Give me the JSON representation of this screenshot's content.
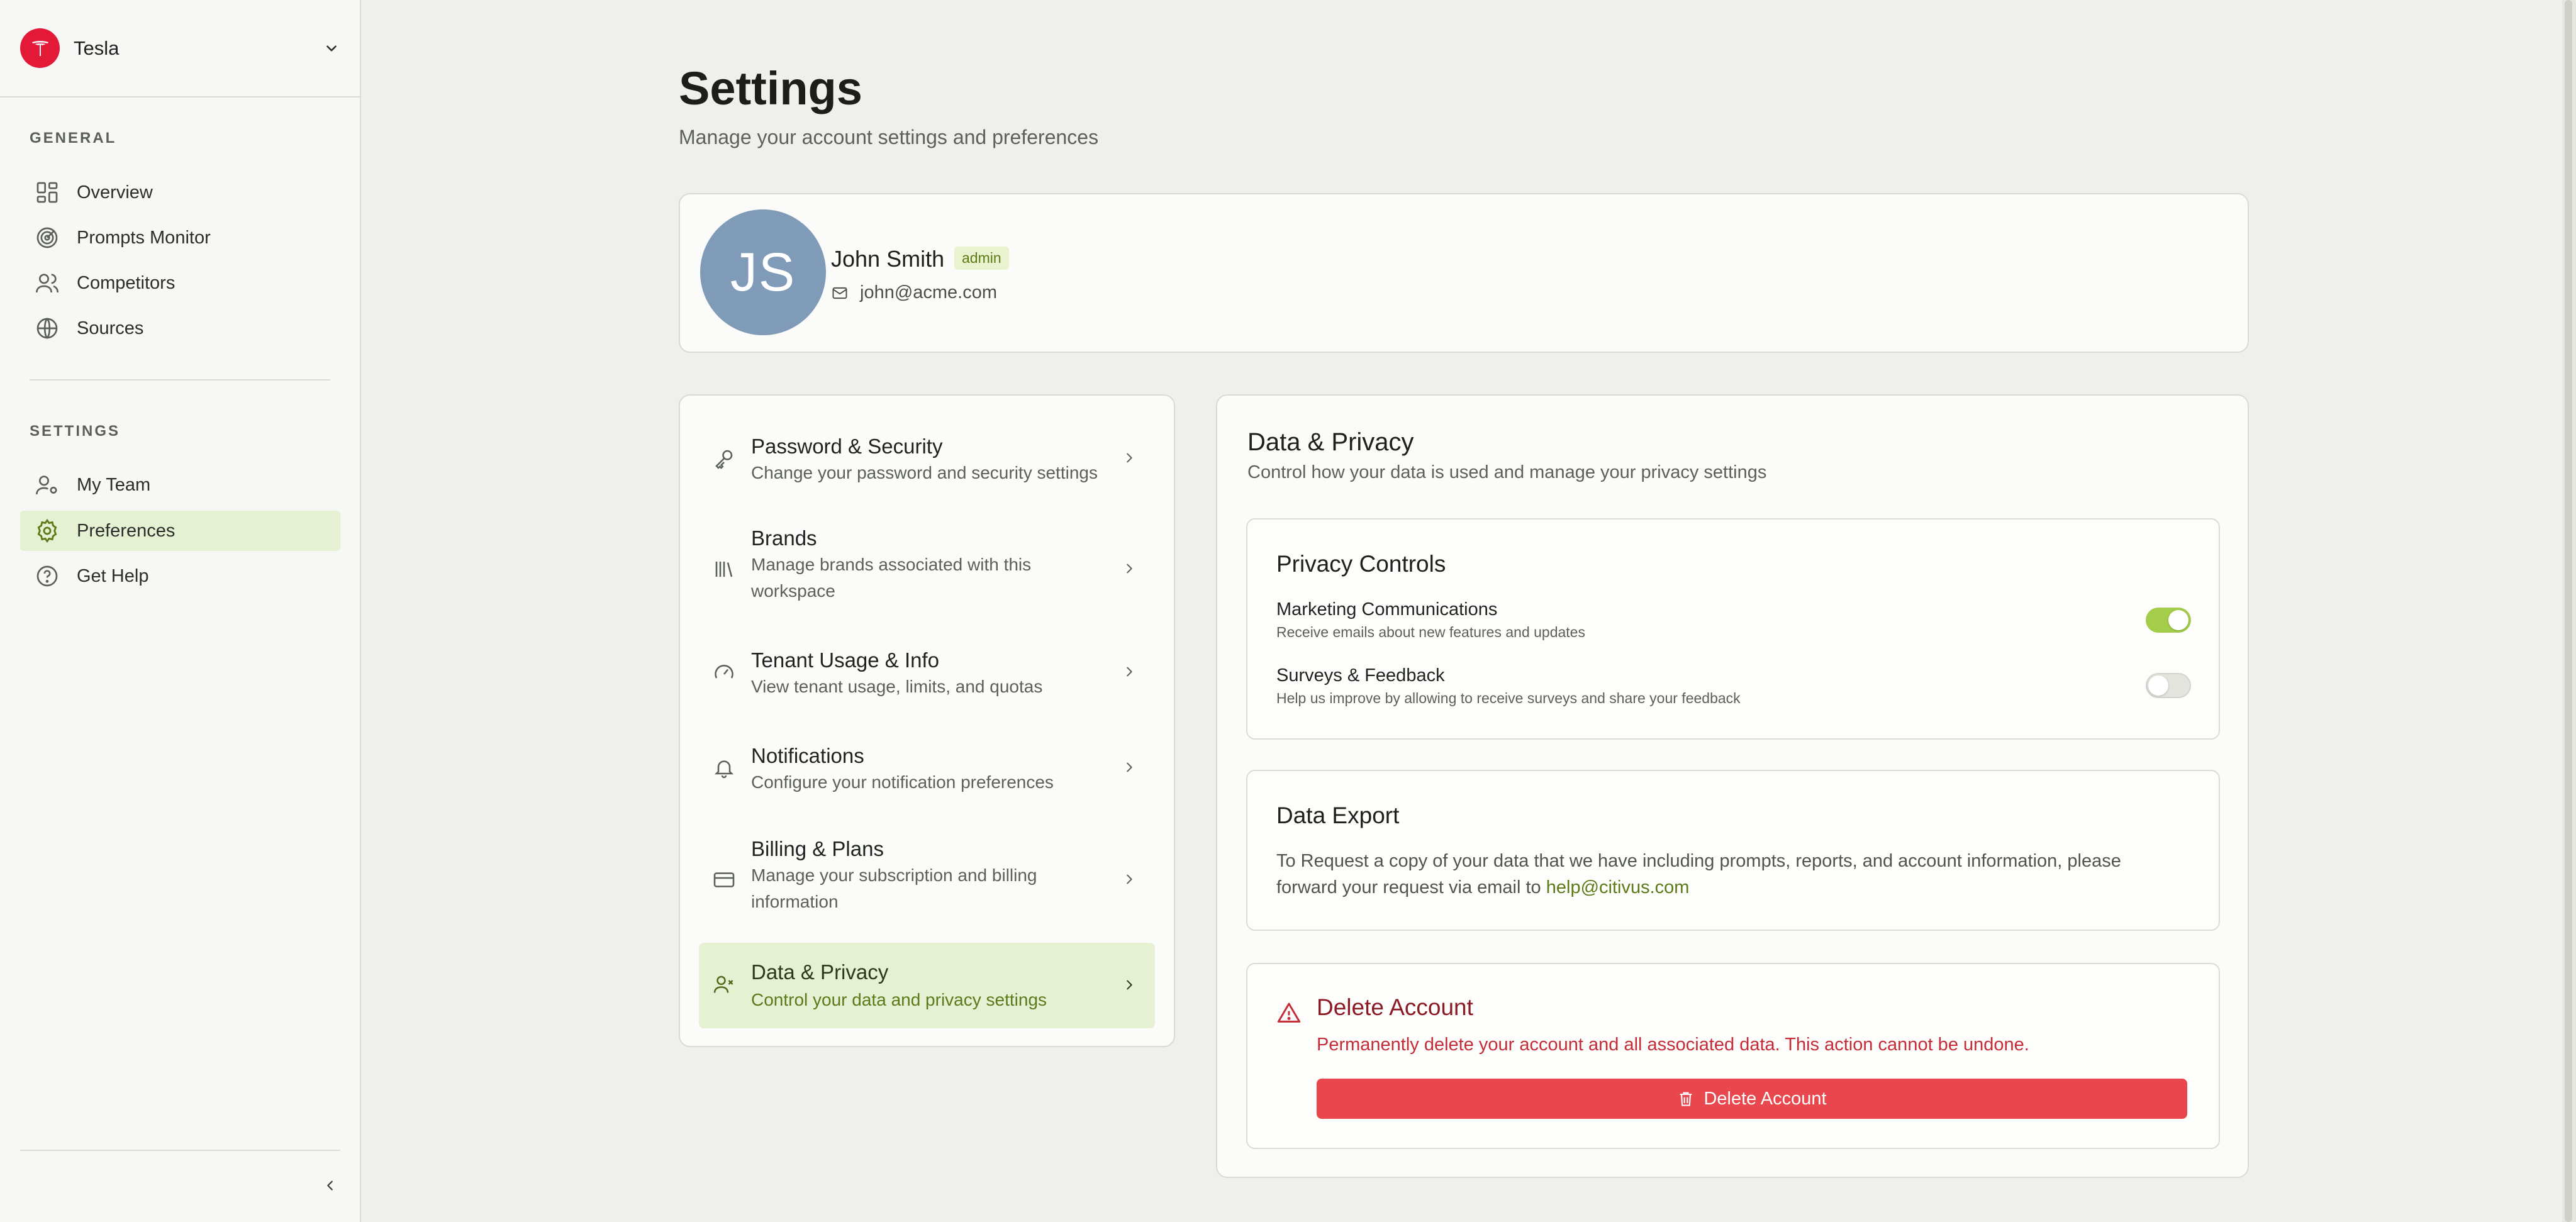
{
  "sidebar": {
    "org_name": "Tesla",
    "general_label": "GENERAL",
    "general_items": [
      {
        "label": "Overview",
        "icon": "grid-icon"
      },
      {
        "label": "Prompts Monitor",
        "icon": "radar-icon"
      },
      {
        "label": "Competitors",
        "icon": "users-icon"
      },
      {
        "label": "Sources",
        "icon": "globe-icon"
      }
    ],
    "settings_label": "SETTINGS",
    "settings_items": [
      {
        "label": "My Team",
        "icon": "user-gear-icon"
      },
      {
        "label": "Preferences",
        "icon": "gear-icon",
        "active": true
      },
      {
        "label": "Get Help",
        "icon": "help-circle-icon"
      }
    ]
  },
  "page": {
    "title": "Settings",
    "subtitle": "Manage your account settings and preferences"
  },
  "profile": {
    "initials": "JS",
    "name": "John Smith",
    "role": "admin",
    "email": "john@acme.com"
  },
  "menu": {
    "items": [
      {
        "title": "Password & Security",
        "desc": "Change your password and security settings",
        "icon": "key-icon"
      },
      {
        "title": "Brands",
        "desc": "Manage brands associated with this workspace",
        "icon": "library-icon"
      },
      {
        "title": "Tenant Usage & Info",
        "desc": "View tenant usage, limits, and quotas",
        "icon": "gauge-icon"
      },
      {
        "title": "Notifications",
        "desc": "Configure your notification preferences",
        "icon": "bell-icon"
      },
      {
        "title": "Billing & Plans",
        "desc": "Manage your subscription and billing information",
        "icon": "credit-card-icon"
      },
      {
        "title": "Data & Privacy",
        "desc": "Control your data and privacy settings",
        "icon": "user-x-icon",
        "active": true
      }
    ]
  },
  "panel": {
    "title": "Data & Privacy",
    "desc": "Control how your data is used and manage your privacy settings",
    "privacy": {
      "title": "Privacy Controls",
      "marketing_title": "Marketing Communications",
      "marketing_desc": "Receive emails about new features and updates",
      "marketing_on": true,
      "surveys_title": "Surveys & Feedback",
      "surveys_desc": "Help us improve by allowing to receive surveys and share your feedback",
      "surveys_on": false
    },
    "export": {
      "title": "Data Export",
      "text": "To Request a copy of your data that we have including prompts, reports, and account information, please forward your request via email to ",
      "email": "help@citivus.com"
    },
    "delete": {
      "title": "Delete Account",
      "desc": "Permanently delete your account and all associated data. This action cannot be undone.",
      "button": "Delete Account"
    }
  },
  "colors": {
    "accent": "#a4cd4a",
    "active_bg": "#e6f0d3",
    "danger": "#e8474e",
    "brand": "#e31937"
  }
}
